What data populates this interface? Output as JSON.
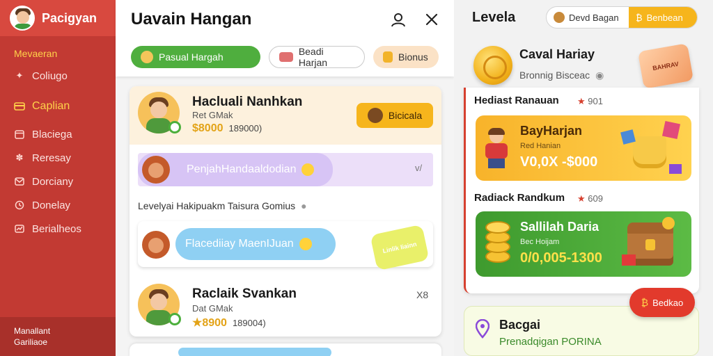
{
  "sidebar": {
    "title": "Pacigyan",
    "section_label": "Mevaeran",
    "items": [
      {
        "label": "Coliugo",
        "icon": "bird-icon"
      },
      {
        "label": "Caplian",
        "icon": "card-icon",
        "active": true
      },
      {
        "label": "Blaciega",
        "icon": "calendar-icon"
      },
      {
        "label": "Reresay",
        "icon": "star-icon"
      },
      {
        "label": "Dorciany",
        "icon": "mail-icon"
      },
      {
        "label": "Donelay",
        "icon": "shield-icon"
      },
      {
        "label": "Berialheos",
        "icon": "chart-icon"
      }
    ],
    "footer_line1": "Manallant",
    "footer_line2": "Gariliaoe"
  },
  "middle": {
    "title": "Uavain Hangan",
    "tabs": [
      {
        "label": "Pasual Hargah",
        "icon": "coins-icon"
      },
      {
        "label": "Beadi Harjan",
        "icon": "gift-icon"
      },
      {
        "label": "Bionus",
        "icon": "bag-icon"
      }
    ],
    "card1": {
      "name": "Hacluali Nanhkan",
      "sub": "Ret GMak",
      "amount": "$8000",
      "amount2": "189000)",
      "button": "Bicicala"
    },
    "pill1": {
      "text": "PenjahHandaaldodian"
    },
    "pill1_chevron": "v/",
    "section_label": "Levelyai Hakipuakm Taisura Gomius",
    "pill2": {
      "text": "Flacediiay MaenIJuan"
    },
    "tag_text": "Linlik Iiainn",
    "card2": {
      "name": "Raclaik Svankan",
      "sub": "Dat GMak",
      "amount": "★8900",
      "amount2": "189004)",
      "meta": "X8"
    }
  },
  "right": {
    "title": "Levela",
    "toggle_a": "Devd Bagan",
    "toggle_b": "Benbean",
    "sub1": "Caval Hariay",
    "sub2": "Bronnig Bisceac",
    "ticket_text": "BAHRAV",
    "section1": {
      "title": "Hediast Ranauan",
      "meta": "901"
    },
    "promo1": {
      "title": "BayHarjan",
      "sub": "Red Hanian",
      "value": "V0,0X -$000"
    },
    "section2": {
      "title": "Radiack Randkum",
      "meta": "609"
    },
    "promo2": {
      "title": "Sallilah Daria",
      "sub": "Bec Hoijam",
      "value": "0/0,005-1300"
    },
    "float_button": "Bedkao",
    "bottom_title": "Bacgai",
    "bottom_sub": "Prenadqigan PORINA"
  },
  "colors": {
    "sidebar_bg": "#c23a33",
    "accent_yellow": "#f6b51c",
    "accent_green": "#4fae3e",
    "pill_purple": "#d7c4f5",
    "pill_blue": "#8fd0f3"
  }
}
